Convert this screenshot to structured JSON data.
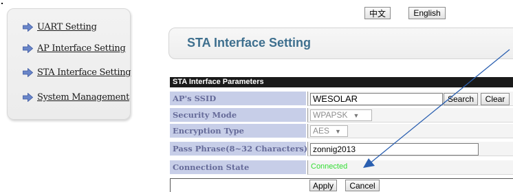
{
  "language_buttons": {
    "chinese": "中文",
    "english": "English"
  },
  "sidebar": {
    "items": [
      {
        "label": "UART Setting"
      },
      {
        "label": "AP Interface Setting"
      },
      {
        "label": "STA Interface Setting"
      },
      {
        "label": "System Management"
      }
    ]
  },
  "page_title": "STA Interface Setting",
  "params": {
    "header": "STA Interface Parameters",
    "ssid": {
      "label": "AP's SSID",
      "value": "WESOLAR",
      "search_label": "Search",
      "clear_label": "Clear"
    },
    "security_mode": {
      "label": "Security Mode",
      "value": "WPAPSK"
    },
    "encryption_type": {
      "label": "Encryption Type",
      "value": "AES"
    },
    "pass_phrase": {
      "label": "Pass Phrase(8~32 Characters)",
      "value": "zonnig2013"
    },
    "connection_state": {
      "label": "Connection State",
      "value": "Connected"
    }
  },
  "actions": {
    "apply_label": "Apply",
    "cancel_label": "Cancel"
  },
  "colors": {
    "title": "#3e6f8e",
    "label_bg": "#c7cee8",
    "label_text": "#666b99",
    "connected": "#33dd33",
    "arrow": "#2a5fb0"
  }
}
